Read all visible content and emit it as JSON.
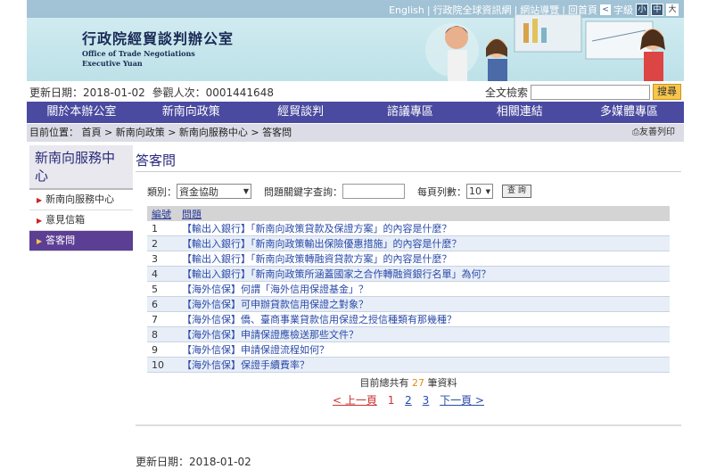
{
  "topbar": {
    "links": [
      "English",
      "行政院全球資訊網",
      "網站導覽",
      "回首頁"
    ],
    "font_label": "字級",
    "font_sizes": [
      "小",
      "中",
      "大"
    ]
  },
  "header": {
    "org_cn": "行政院經貿談判辦公室",
    "org_en1": "Office of Trade Negotiations",
    "org_en2": "Executive Yuan"
  },
  "info": {
    "update_label": "更新日期：",
    "update_date": "2018-01-02",
    "visits_label": "參觀人次：",
    "visits": "0001441648"
  },
  "search": {
    "label": "全文檢索",
    "button": "搜尋"
  },
  "nav": [
    "關於本辦公室",
    "新南向政策",
    "經貿談判",
    "諮議專區",
    "相關連結",
    "多媒體專區"
  ],
  "breadcrumb": {
    "text": "目前位置： 首頁 > 新南向政策 > 新南向服務中心 > 答客問",
    "print": "友善列印"
  },
  "sidebar": {
    "title": "新南向服務中心",
    "items": [
      {
        "label": "新南向服務中心",
        "active": false
      },
      {
        "label": "意見信箱",
        "active": false
      },
      {
        "label": "答客問",
        "active": true
      }
    ]
  },
  "main": {
    "title": "答客問",
    "filters": {
      "category_label": "類別：",
      "category_value": "資金協助",
      "keyword_label": "問題關鍵字查詢：",
      "perpage_label": "每頁列數：",
      "perpage_value": "10",
      "query_button": "查 詢"
    },
    "table": {
      "headers": [
        "編號",
        "問題"
      ],
      "rows": [
        {
          "num": "1",
          "q": "【輸出入銀行】「新南向政策貸款及保證方案」的內容是什麼？"
        },
        {
          "num": "2",
          "q": "【輸出入銀行】「新南向政策輸出保險優惠措施」的內容是什麼？"
        },
        {
          "num": "3",
          "q": "【輸出入銀行】「新南向政策轉融資貸款方案」的內容是什麼？"
        },
        {
          "num": "4",
          "q": "【輸出入銀行】「新南向政策所涵蓋國家之合作轉融資銀行名單」為何？"
        },
        {
          "num": "5",
          "q": "【海外信保】何謂「海外信用保證基金」？"
        },
        {
          "num": "6",
          "q": "【海外信保】可申辦貸款信用保證之對象？"
        },
        {
          "num": "7",
          "q": "【海外信保】僑、臺商事業貸款信用保證之授信種類有那幾種？"
        },
        {
          "num": "8",
          "q": "【海外信保】申請保證應檢送那些文件？"
        },
        {
          "num": "9",
          "q": "【海外信保】申請保證流程如何？"
        },
        {
          "num": "10",
          "q": "【海外信保】保證手續費率？"
        }
      ]
    },
    "total": {
      "prefix": "目前總共有",
      "count": "27",
      "suffix": "筆資料"
    },
    "pager": {
      "prev": "< 上一頁",
      "pages": [
        "1",
        "2",
        "3"
      ],
      "current": "1",
      "next": "下一頁 >"
    }
  },
  "footer": {
    "update": "更新日期：2018-01-02"
  }
}
